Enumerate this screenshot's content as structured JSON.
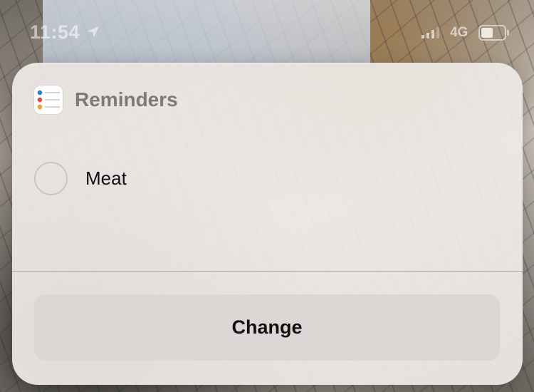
{
  "status_bar": {
    "time": "11:54",
    "network": "4G"
  },
  "widget": {
    "app_name": "Reminders",
    "items": [
      {
        "label": "Meat",
        "completed": false
      }
    ],
    "button_label": "Change"
  },
  "colors": {
    "widget_bg": "#eee9e6",
    "button_bg": "#dad7d5",
    "title_gray": "#7e7a78",
    "dot_blue": "#1a7cf5",
    "dot_red": "#f0423a",
    "dot_orange": "#f59a23"
  },
  "icons": {
    "location": "location-arrow-icon",
    "signal": "cellular-signal-icon",
    "battery": "battery-icon",
    "app": "reminders-app-icon"
  }
}
